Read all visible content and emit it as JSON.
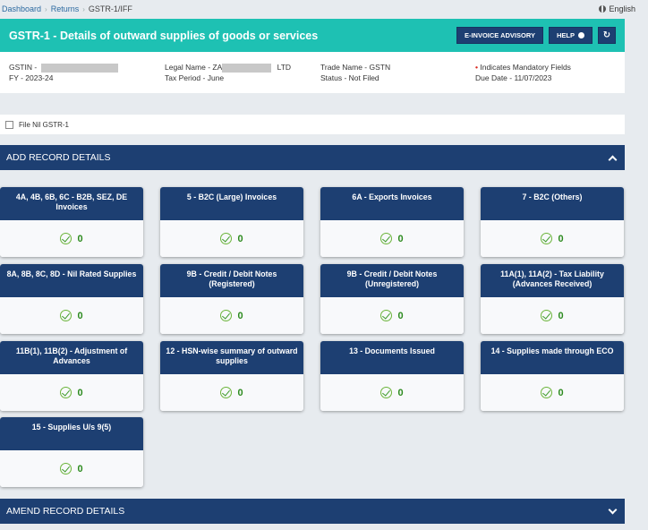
{
  "breadcrumb": {
    "items": [
      "Dashboard",
      "Returns"
    ],
    "current": "GSTR-1/IFF",
    "separator": "›"
  },
  "language": "English",
  "header": {
    "title": "GSTR-1 - Details of outward supplies of goods or services",
    "einvoice_label": "E-INVOICE ADVISORY",
    "help_label": "HELP",
    "refresh_icon": "↻"
  },
  "info": {
    "gstin_label": "GSTIN -",
    "fy": "FY - 2023-24",
    "legal_name_label": "Legal Name - ZA",
    "legal_name_suffix": "LTD",
    "tax_period": "Tax Period - June",
    "trade_name": "Trade Name - GSTN",
    "status": "Status - Not Filed",
    "mandatory_note": "Indicates Mandatory Fields",
    "due_date": "Due Date - 11/07/2023"
  },
  "nil": {
    "label": "File Nil GSTR-1"
  },
  "add_section": {
    "title": "ADD RECORD DETAILS"
  },
  "amend_section": {
    "title": "AMEND RECORD DETAILS"
  },
  "tiles": [
    {
      "title": "4A, 4B, 6B, 6C - B2B, SEZ, DE Invoices",
      "count": "0"
    },
    {
      "title": "5 - B2C (Large) Invoices",
      "count": "0"
    },
    {
      "title": "6A - Exports Invoices",
      "count": "0"
    },
    {
      "title": "7 - B2C (Others)",
      "count": "0"
    },
    {
      "title": "8A, 8B, 8C, 8D - Nil Rated Supplies",
      "count": "0"
    },
    {
      "title": "9B - Credit / Debit Notes (Registered)",
      "count": "0"
    },
    {
      "title": "9B - Credit / Debit Notes (Unregistered)",
      "count": "0"
    },
    {
      "title": "11A(1), 11A(2) - Tax Liability (Advances Received)",
      "count": "0"
    },
    {
      "title": "11B(1), 11B(2) - Adjustment of Advances",
      "count": "0"
    },
    {
      "title": "12 - HSN-wise summary of outward supplies",
      "count": "0"
    },
    {
      "title": "13 - Documents Issued",
      "count": "0"
    },
    {
      "title": "14 - Supplies made through ECO",
      "count": "0"
    },
    {
      "title": "15 - Supplies U/s 9(5)",
      "count": "0"
    }
  ],
  "colors": {
    "header_teal": "#1ec1b3",
    "navy": "#1d3f72",
    "success_green": "#2c8a1e"
  }
}
